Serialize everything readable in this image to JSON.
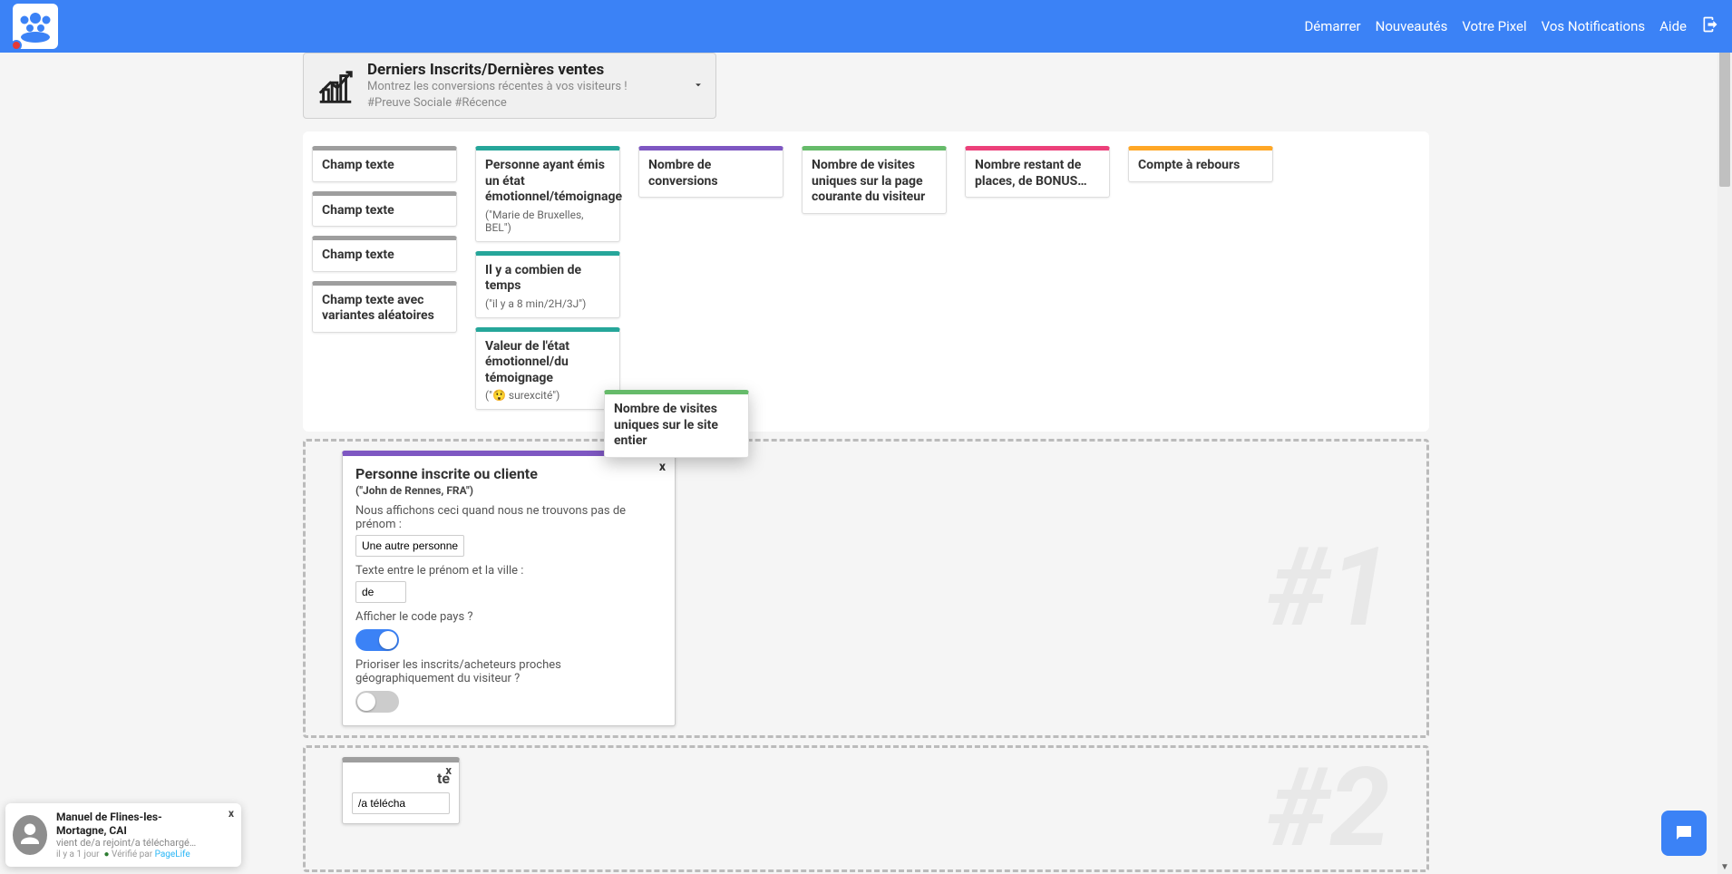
{
  "nav": {
    "items": [
      "Démarrer",
      "Nouveautés",
      "Votre Pixel",
      "Vos Notifications",
      "Aide"
    ]
  },
  "header_card": {
    "title": "Derniers Inscrits/Dernières ventes",
    "line1": "Montrez les conversions récentes à vos visiteurs !",
    "line2": "#Preuve Sociale #Récence"
  },
  "widgets": {
    "col_gray": [
      {
        "title": "Champ texte"
      },
      {
        "title": "Champ texte"
      },
      {
        "title": "Champ texte"
      },
      {
        "title": "Champ texte avec variantes aléatoires"
      }
    ],
    "col_teal": [
      {
        "title": "Personne ayant émis un état émotionnel/témoignage",
        "sub": "(\"Marie de Bruxelles, BEL\")"
      },
      {
        "title": "Il y a combien de temps",
        "sub": "(\"il y a 8 min/2H/3J\")"
      },
      {
        "title": "Valeur de l'état émotionnel/du témoignage",
        "sub": "(\"😲 surexcité\")"
      }
    ],
    "purple": {
      "title": "Nombre de conversions"
    },
    "green1": {
      "title": "Nombre de visites uniques sur la page courante du visiteur"
    },
    "dragging": {
      "title": "Nombre de visites uniques sur le site entier"
    },
    "pink": {
      "title": "Nombre restant de places, de BONUS…"
    },
    "orange": {
      "title": "Compte à rebours"
    }
  },
  "config_panel": {
    "title": "Personne inscrite ou cliente",
    "example": "(\"John de Rennes, FRA\")",
    "label_noname": "Nous affichons ceci quand nous ne trouvons pas de prénom :",
    "value_noname": "Une autre personne",
    "label_between": "Texte entre le prénom et la ville :",
    "value_between": "de",
    "label_country": "Afficher le code pays ?",
    "label_prioritize": "Prioriser les inscrits/acheteurs proches géographiquement du visiteur ?",
    "close": "x"
  },
  "zone_labels": {
    "z1": "#1",
    "z2": "#2"
  },
  "zone2_card": {
    "title_suffix": "te",
    "input_value": "/a télécha",
    "close": "x"
  },
  "notif": {
    "title": "Manuel de Flines-les-Mortagne, CAI",
    "sub": "vient de/a rejoint/a téléchargé…",
    "time": "il y a 1 jour",
    "verified_label": "Vérifié par",
    "brand": "PageLife",
    "close": "x"
  }
}
